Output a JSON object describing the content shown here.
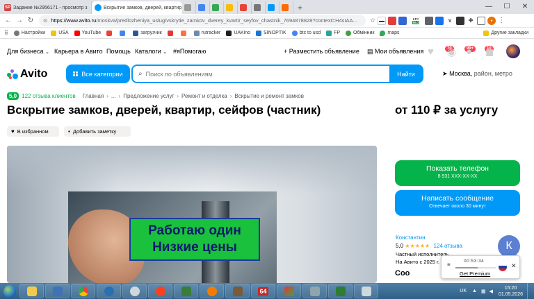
{
  "browser": {
    "tabs": [
      {
        "label": "Задание №2956171 - просмотр з",
        "favicon": "SP",
        "color": "#d64545",
        "active": false
      },
      {
        "label": "Вскрытие замков, дверей, квартир",
        "favicon": "",
        "color": "#0099f7",
        "active": true
      }
    ],
    "url_host": "https://www.avito.ru",
    "url_path": "/moskva/predlozheniya_uslug/vskrytie_zamkov_dverey_kvartir_seyfov_chastnik_7694878828?context=H4sIAA...",
    "bookmarks": [
      "Настройки",
      "USA",
      "YouTube",
      "загрузчик",
      "rutracker",
      "UAKino",
      "SINOPTIK",
      "btc to usd",
      "FP",
      "Обмінник",
      "maps"
    ],
    "bookmarks_other": "Другие закладки",
    "ext_ltc": "LTC",
    "ext_value": "55.3"
  },
  "avito": {
    "menu": {
      "business": "Для бизнеса",
      "career": "Карьера в Авито",
      "help": "Помощь",
      "catalogs": "Каталоги",
      "help_tag": "#яПомогаю",
      "post": "+ Разместить объявление",
      "my_ads": "Мои объявления",
      "fav_count": "70",
      "msg_count": "99+",
      "notif_count": "10"
    },
    "logo": "Avito",
    "categories_btn": "Все категории",
    "search_placeholder": "Поиск по объявлениям",
    "search_btn": "Найти",
    "location": "Москва,",
    "location_rest": " район, метро",
    "breadcrumb": {
      "rating": "5,0",
      "reviews": "122 отзыва клиентов",
      "items": [
        "Главная",
        "...",
        "Предложение услуг",
        "Ремонт и отделка",
        "Вскрытие и ремонт замков"
      ]
    },
    "title": "Вскрытие замков, дверей, квартир, сейфов (частник)",
    "price": "от 110 ₽ за услугу",
    "favorite_btn": "В избранном",
    "note_btn": "Добавить заметку",
    "promo_line1": "Работаю один",
    "promo_line2": "Низкие цены",
    "call_btn": "Показать телефон",
    "call_sub": "8 931 XXX-XX-XX",
    "msg_btn": "Написать сообщение",
    "msg_sub": "Отвечает около 30 минут",
    "seller": {
      "name": "Константин",
      "rating": "5,0",
      "stars": "★★★★★",
      "reviews": "124 отзыва",
      "type": "Частный исполнитель",
      "since": "На Авито с 2025 г.",
      "avatar_letter": "К"
    },
    "peek": "Соо"
  },
  "recorder": {
    "time": "00:53:34",
    "premium": "Get Premium",
    "progress": 0.55
  },
  "taskbar": {
    "lang": "UK",
    "time": "15:20",
    "date": "01.05.2026",
    "app_64": "64"
  },
  "colors": {
    "avito_blue": "#0099f7",
    "avito_green": "#04b34a",
    "promo_green": "#1ac13c",
    "promo_text": "#0d1b6e"
  }
}
